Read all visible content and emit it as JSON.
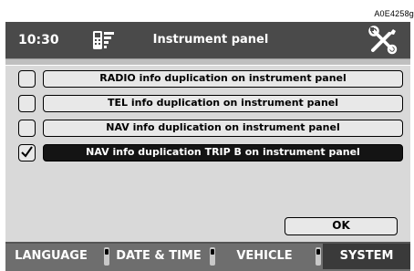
{
  "figure_code": "A0E4258g",
  "header": {
    "time": "10:30",
    "title": "Instrument panel",
    "phone_icon": "phone-signal-icon",
    "tools_icon": "tools-icon"
  },
  "options": [
    {
      "label": "RADIO info duplication on instrument panel",
      "checked": false,
      "selected": false
    },
    {
      "label": "TEL info duplication on instrument panel",
      "checked": false,
      "selected": false
    },
    {
      "label": "NAV info duplication on instrument panel",
      "checked": false,
      "selected": false
    },
    {
      "label": "NAV info duplication TRIP B on instrument panel",
      "checked": true,
      "selected": true
    }
  ],
  "ok_label": "OK",
  "tabs": [
    {
      "label": "LANGUAGE",
      "active": false
    },
    {
      "label": "DATE & TIME",
      "active": false
    },
    {
      "label": "VEHICLE",
      "active": false
    },
    {
      "label": "SYSTEM",
      "active": true
    }
  ],
  "colors": {
    "header_bg": "#4a4a4a",
    "screen_bg": "#d9d9d9",
    "selected_bg": "#141414",
    "tabbar_bg": "#6e6e6e",
    "active_tab_bg": "#3a3a3a"
  }
}
